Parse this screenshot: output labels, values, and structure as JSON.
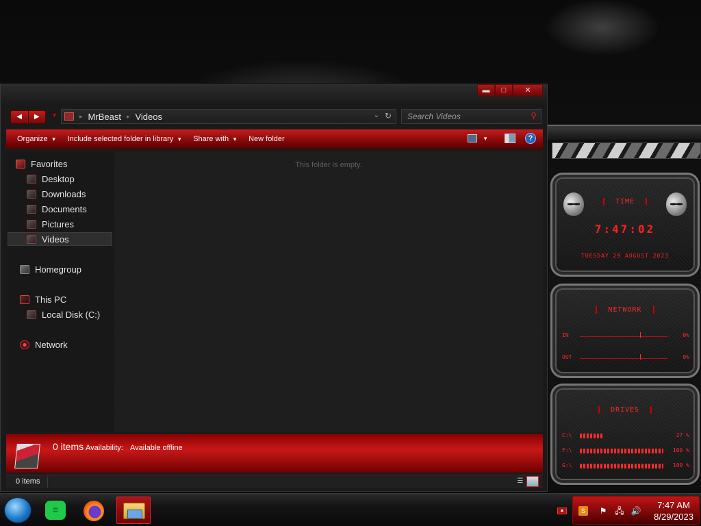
{
  "window": {
    "caption": {
      "minimize": "▬",
      "maximize": "□",
      "close": "✕"
    },
    "nav": {
      "back": "◀",
      "forward": "▶",
      "recent": "▼"
    },
    "breadcrumbs": [
      {
        "label": "MrBeast"
      },
      {
        "label": "Videos"
      }
    ],
    "search": {
      "placeholder": "Search Videos"
    },
    "toolbar": {
      "organize": "Organize",
      "include": "Include selected folder in library",
      "share": "Share with",
      "new_folder": "New folder"
    },
    "nav_pane": {
      "favorites": "Favorites",
      "desktop": "Desktop",
      "downloads": "Downloads",
      "documents": "Documents",
      "pictures": "Pictures",
      "videos": "Videos",
      "homegroup": "Homegroup",
      "this_pc": "This PC",
      "local_disk": "Local Disk (C:)",
      "network": "Network"
    },
    "content": {
      "empty_message": "This folder is empty."
    },
    "details": {
      "count": "0 items",
      "availability_label": "Availability:",
      "availability_value": "Available offline"
    },
    "status": {
      "count": "0 items"
    }
  },
  "gadgets": {
    "clock": {
      "title": "TIME",
      "time": "7:47:02",
      "date": "TUESDAY 29 AUGUST 2023"
    },
    "network": {
      "title": "NETWORK",
      "in_label": "IN",
      "in_pct": "0%",
      "out_label": "OUT",
      "out_pct": "0%"
    },
    "drives": {
      "title": "DRIVES",
      "items": [
        {
          "label": "C:\\",
          "pct": "27 %",
          "fill": 0.27
        },
        {
          "label": "F:\\",
          "pct": "100 %",
          "fill": 1.0
        },
        {
          "label": "G:\\",
          "pct": "100 %",
          "fill": 1.0
        }
      ]
    }
  },
  "taskbar": {
    "clock_time": "7:47 AM",
    "clock_date": "8/29/2023",
    "show_hidden": "▲"
  },
  "colors": {
    "accent": "#c41c1c",
    "accent_dark": "#5a0000",
    "gadget_red": "#ff2a2a"
  }
}
